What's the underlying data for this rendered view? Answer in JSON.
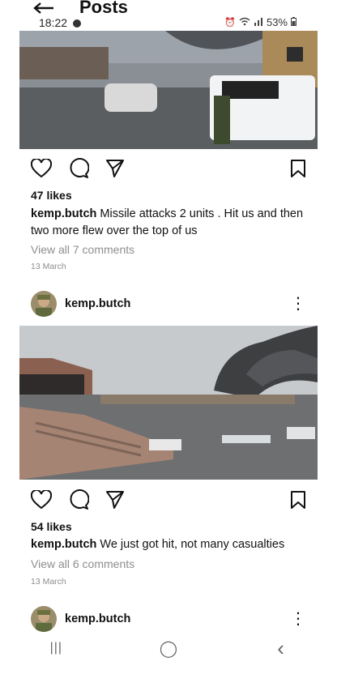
{
  "status": {
    "time": "18:22",
    "battery": "53%"
  },
  "header": {
    "title": "Posts"
  },
  "posts": [
    {
      "likes": "47 likes",
      "username": "kemp.butch",
      "caption": "Missile attacks 2 units . Hit us and then two more flew over the top of us",
      "comments": "View all 7 comments",
      "date": "13 March"
    },
    {
      "username": "kemp.butch",
      "likes": "54 likes",
      "caption": "We just got hit, not many casualties",
      "comments": "View all 6 comments",
      "date": "13 March"
    },
    {
      "username": "kemp.butch"
    }
  ],
  "navbar": {
    "recents": "|||",
    "home": "◯",
    "back": "‹"
  }
}
